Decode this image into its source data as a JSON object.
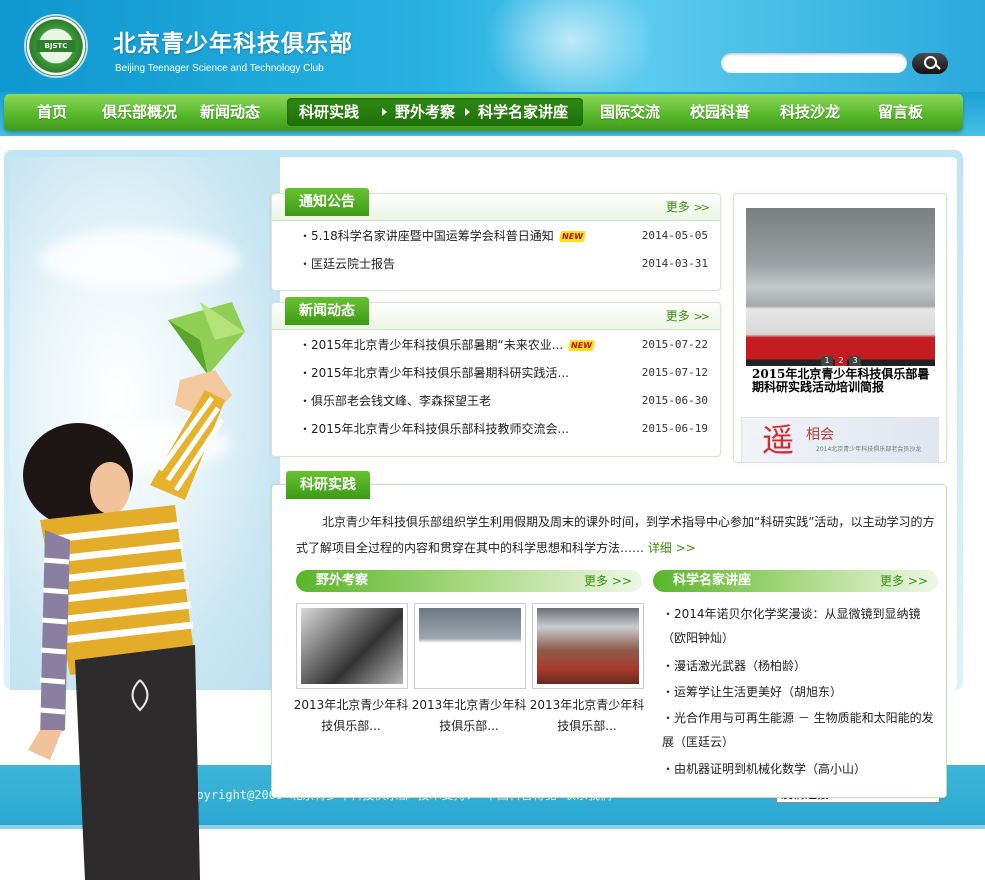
{
  "header": {
    "logo_text": "BJSTC",
    "title": "北京青少年科技俱乐部",
    "subtitle": "Beijing Teenager Science and Technology Club",
    "search": {
      "value": "",
      "placeholder": ""
    }
  },
  "nav": {
    "items": [
      "首页",
      "俱乐部概况",
      "新闻动态",
      "国际交流",
      "校园科普",
      "科技沙龙",
      "留言板"
    ],
    "active": "科研实践",
    "sub_items": [
      "野外考察",
      "科学名家讲座"
    ]
  },
  "notices": {
    "title": "通知公告",
    "more": "更多",
    "items": [
      {
        "text": "・5.18科学名家讲座暨中国运筹学会科普日通知",
        "new": "NEW",
        "date": "2014-05-05"
      },
      {
        "text": "・匡廷云院士报告",
        "date": "2014-03-31"
      }
    ]
  },
  "news": {
    "title": "新闻动态",
    "more": "更多",
    "items": [
      {
        "text": "・2015年北京青少年科技俱乐部暑期“未来农业...",
        "new": "NEW",
        "date": "2015-07-22"
      },
      {
        "text": "・2015年北京青少年科技俱乐部暑期科研实践活...",
        "date": "2015-07-12"
      },
      {
        "text": "・俱乐部老会钱文峰、李森探望王老",
        "date": "2015-06-30"
      },
      {
        "text": "・2015年北京青少年科技俱乐部科技教师交流会...",
        "date": "2015-06-19"
      }
    ]
  },
  "photo": {
    "caption": "2015年北京青少年科技俱乐部暑期科研实践活动培训简报",
    "dots": [
      "1",
      "2",
      "3"
    ],
    "banner_glyph": "遥",
    "banner_title": "相会",
    "banner_sub": "2014北京青少年科技俱乐部老会员沙龙"
  },
  "research": {
    "title": "科研实践",
    "intro": "北京青少年科技俱乐部组织学生利用假期及周末的课外时间，到学术指导中心参加“科研实践”活动，以主动学习的方式了解项目全过程的内容和贯穿在其中的科学思想和科学方法……",
    "detail": "详细",
    "field": {
      "title": "野外考察",
      "more": "更多",
      "captions": [
        "2013年北京青少年科技俱乐部...",
        "2013年北京青少年科技俱乐部...",
        "2013年北京青少年科技俱乐部..."
      ]
    },
    "lectures": {
      "title": "科学名家讲座",
      "more": "更多",
      "items": [
        "・2014年诺贝尔化学奖漫谈：从显微镜到显纳镜（欧阳钟灿）",
        "・漫话激光武器（杨柏龄）",
        "・运筹学让生活更美好（胡旭东）",
        "・光合作用与可再生能源 － 生物质能和太阳能的发展（匡廷云）",
        "・由机器证明到机械化数学（高小山）"
      ]
    }
  },
  "footer": {
    "copyright": "Copyright@2009 北京青少年科技俱乐部  技术支持：  中国科普博览  联系我们",
    "friend_links": "友情连接",
    "friend_links_sep": ":::::::::::",
    "dropdown_arrow": "▼"
  },
  "colors": {
    "nav_green": "#58b82b",
    "header_blue": "#1a9fd5",
    "more_green": "#3d8d12"
  }
}
